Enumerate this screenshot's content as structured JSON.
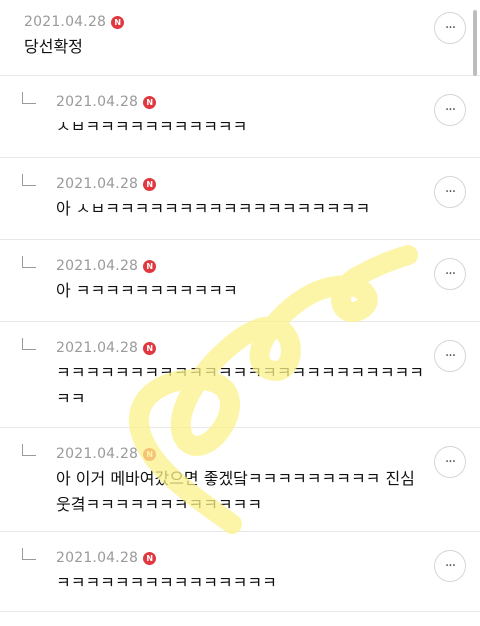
{
  "comments": [
    {
      "date": "2021.04.28",
      "badge": "N",
      "text": "당선확정",
      "more": "···",
      "reply": false
    },
    {
      "date": "2021.04.28",
      "badge": "N",
      "text": "ㅅㅂㅋㅋㅋㅋㅋㅋㅋㅋㅋㅋㅋ",
      "more": "···",
      "reply": true
    },
    {
      "date": "2021.04.28",
      "badge": "N",
      "text": "아 ㅅㅂㅋㅋㅋㅋㅋㅋㅋㅋㅋㅋㅋㅋㅋㅋㅋㅋㅋㅋ",
      "more": "···",
      "reply": true
    },
    {
      "date": "2021.04.28",
      "badge": "N",
      "text": "아 ㅋㅋㅋㅋㅋㅋㅋㅋㅋㅋㅋ",
      "more": "···",
      "reply": true
    },
    {
      "date": "2021.04.28",
      "badge": "N",
      "text": "ㅋㅋㅋㅋㅋㅋㅋㅋㅋㅋㅋㅋㅋㅋㅋㅋㅋㅋㅋㅋㅋㅋㅋㅋㅋ\nㅋㅋ",
      "more": "···",
      "reply": true
    },
    {
      "date": "2021.04.28",
      "badge": "N",
      "text": "아 이거 메바여갔으면 좋겠닼ㅋㅋㅋㅋㅋㅋㅋㅋㅋ 진심\n웃곀ㅋㅋㅋㅋㅋㅋㅋㅋㅋㅋㅋㅋ",
      "more": "···",
      "reply": true
    },
    {
      "date": "2021.04.28",
      "badge": "N",
      "text": "ㅋㅋㅋㅋㅋㅋㅋㅋㅋㅋㅋㅋㅋㅋㅋ",
      "more": "···",
      "reply": true
    }
  ],
  "colors": {
    "badge": "#e0383e",
    "date": "#9a9a9a",
    "squiggle": "#fbf28a"
  }
}
